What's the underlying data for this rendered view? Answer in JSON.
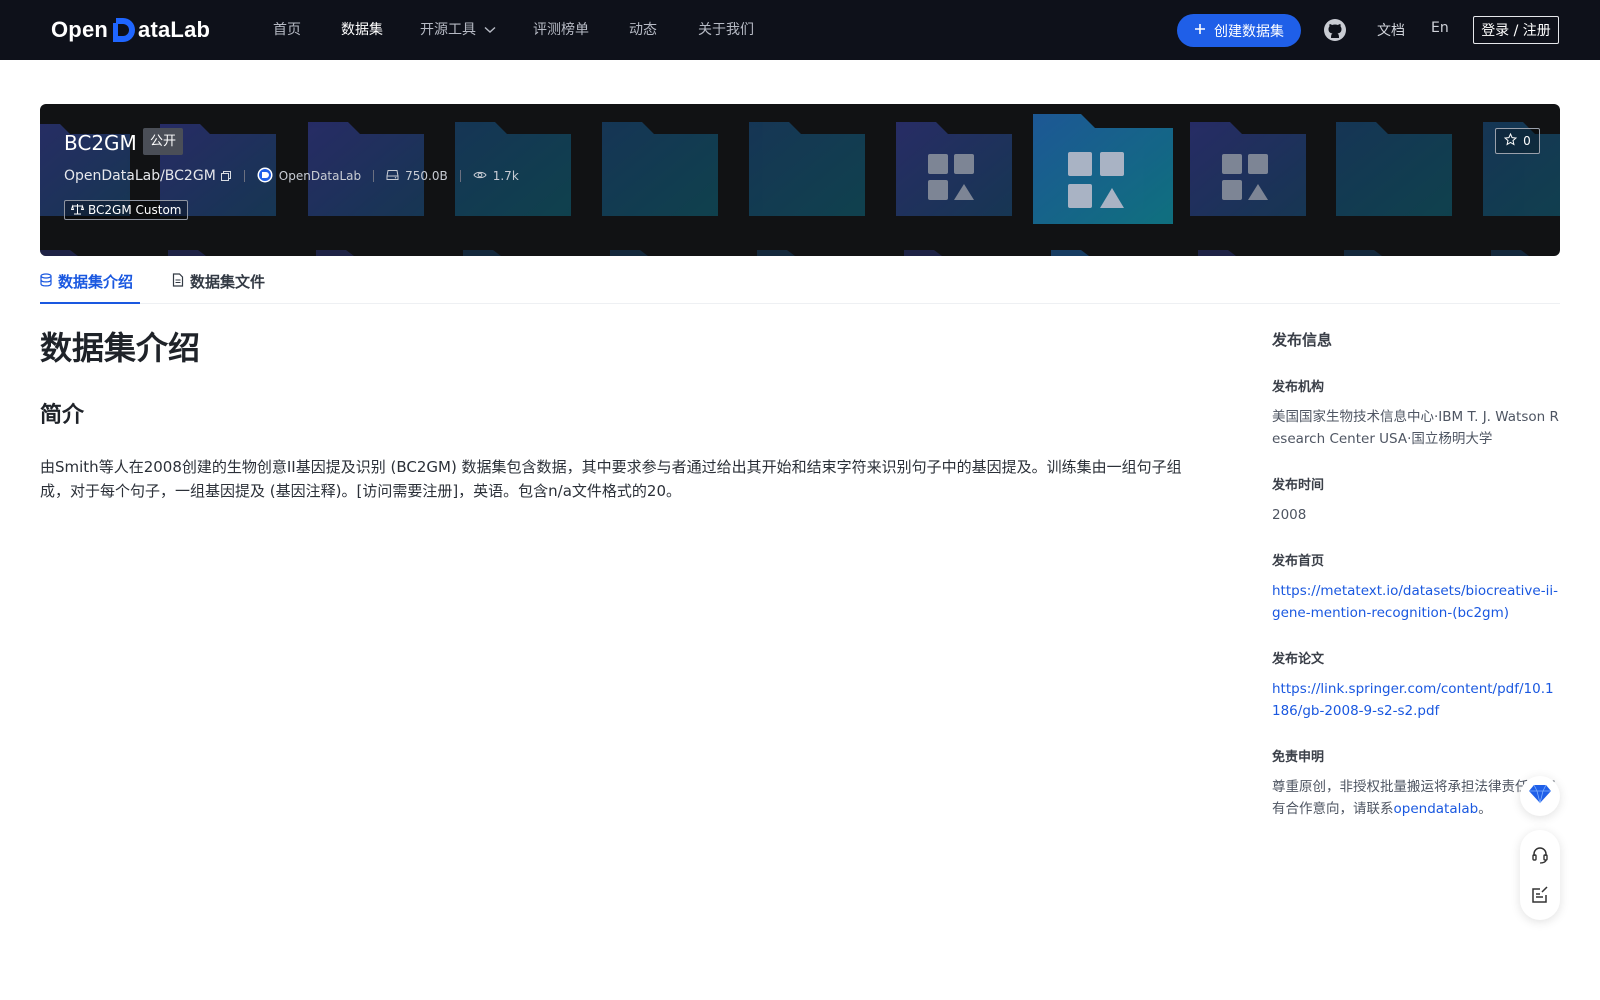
{
  "header": {
    "logo_text_left": "Open",
    "logo_text_right": "ataLab",
    "nav": [
      "首页",
      "数据集",
      "开源工具",
      "评测榜单",
      "动态",
      "关于我们"
    ],
    "create_button": "创建数据集",
    "docs": "文档",
    "lang": "En",
    "login": "登录 / 注册"
  },
  "dataset": {
    "title": "BC2GM",
    "visibility": "公开",
    "path": "OpenDataLab/BC2GM",
    "publisher": "OpenDataLab",
    "size": "750.0B",
    "views": "1.7k",
    "license": "BC2GM Custom",
    "stars": "0"
  },
  "tabs": [
    "数据集介绍",
    "数据集文件"
  ],
  "main": {
    "heading": "数据集介绍",
    "subheading": "简介",
    "description": "由Smith等人在2008创建的生物创意II基因提及识别 (BC2GM) 数据集包含数据，其中要求参与者通过给出其开始和结束字符来识别句子中的基因提及。训练集由一组句子组成，对于每个句子，一组基因提及 (基因注释)。[访问需要注册]，英语。包含n/a文件格式的20。"
  },
  "side": {
    "title": "发布信息",
    "org_label": "发布机构",
    "org_value": "美国国家生物技术信息中心·IBM T. J. Watson Research Center USA·国立杨明大学",
    "time_label": "发布时间",
    "time_value": "2008",
    "home_label": "发布首页",
    "home_value": "https://metatext.io/datasets/biocreative-ii-gene-mention-recognition-(bc2gm)",
    "paper_label": "发布论文",
    "paper_value": "https://link.springer.com/content/pdf/10.1186/gb-2008-9-s2-s2.pdf",
    "disclaimer_label": "免责申明",
    "disclaimer_text": "尊重原创，非授权批量搬运将承担法律责任。如有合作意向，请联系",
    "disclaimer_link": "opendatalab",
    "disclaimer_end": "。"
  },
  "colors": {
    "nav_bg": "#0e111a",
    "accent": "#1f5fe8",
    "banner_bg": "#111214"
  },
  "icons": [
    "github-icon",
    "plus-icon",
    "copy-icon",
    "storage-icon",
    "eye-icon",
    "scale-icon",
    "star-icon",
    "database-icon",
    "file-icon",
    "headset-icon",
    "feedback-icon",
    "diamond-icon"
  ]
}
